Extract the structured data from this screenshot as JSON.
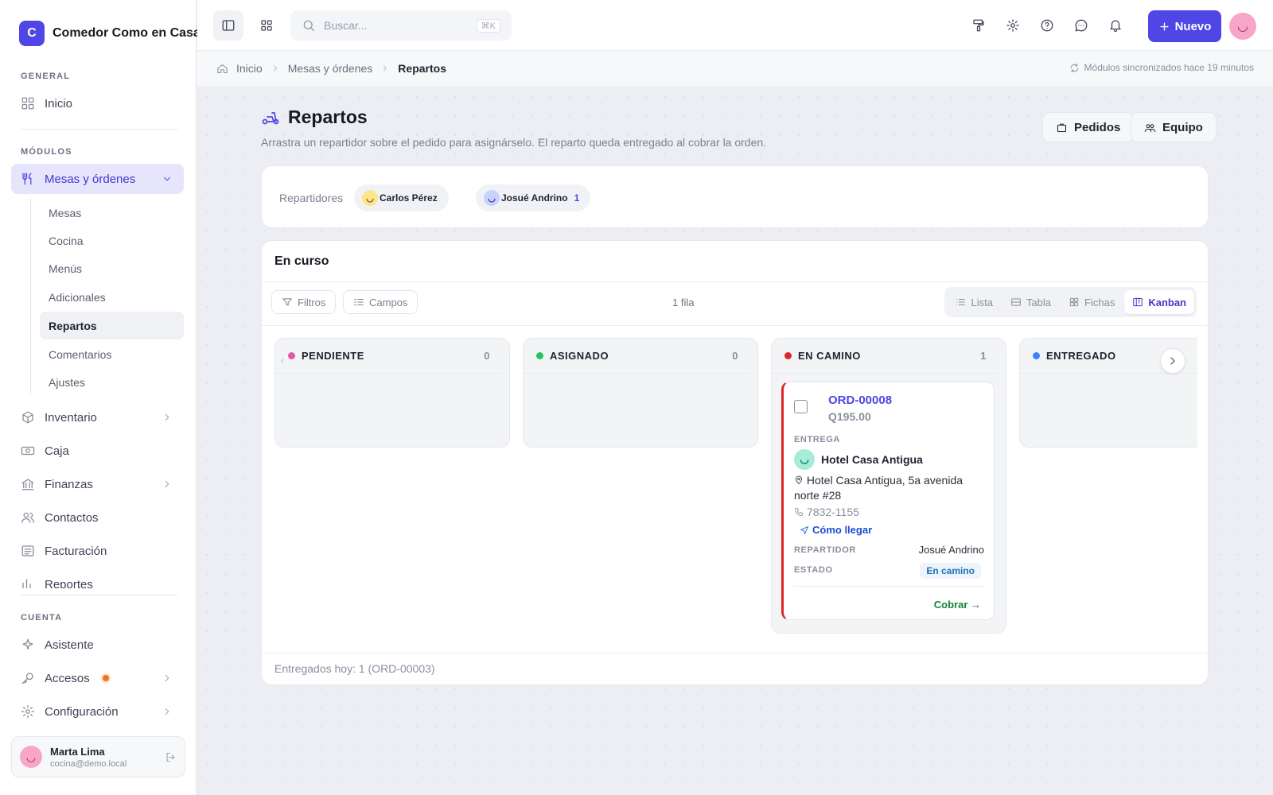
{
  "brand": {
    "initial": "C",
    "name": "Comedor Como en Casa"
  },
  "sidebar": {
    "general_label": "GENERAL",
    "home": "Inicio",
    "modules_label": "MÓDULOS",
    "mesas": "Mesas y órdenes",
    "subitems": [
      "Mesas",
      "Cocina",
      "Menús",
      "Adicionales",
      "Repartos",
      "Comentarios",
      "Ajustes"
    ],
    "inventario": "Inventario",
    "caja": "Caja",
    "finanzas": "Finanzas",
    "contactos": "Contactos",
    "facturacion": "Facturación",
    "reportes": "Reportes",
    "account_label": "CUENTA",
    "asistente": "Asistente",
    "accesos": "Accesos",
    "configuracion": "Configuración"
  },
  "user": {
    "name": "Marta Lima",
    "email": "cocina@demo.local"
  },
  "topbar": {
    "search_placeholder": "Buscar...",
    "shortcut": "⌘K",
    "new_label": "Nuevo"
  },
  "breadcrumb": {
    "home": "Inicio",
    "section": "Mesas y órdenes",
    "current": "Repartos",
    "sync": "Módulos sincronizados hace 19 minutos"
  },
  "page": {
    "title": "Repartos",
    "subtitle": "Arrastra un repartidor sobre el pedido para asignárselo. El reparto queda entregado al cobrar la orden.",
    "btn_orders": "Pedidos",
    "btn_team": "Equipo"
  },
  "repartidores": {
    "label": "Repartidores",
    "items": [
      {
        "name": "Carlos Pérez",
        "count": ""
      },
      {
        "name": "Josué Andrino",
        "count": "1"
      }
    ]
  },
  "board": {
    "title": "En curso",
    "filters": "Filtros",
    "fields": "Campos",
    "rows": "1 fila",
    "views": [
      "Lista",
      "Tabla",
      "Fichas",
      "Kanban"
    ],
    "active_view": "Kanban",
    "columns": [
      {
        "name": "PENDIENTE",
        "count": "0",
        "color": "#e05aa8"
      },
      {
        "name": "ASIGNADO",
        "count": "0",
        "color": "#22c55e"
      },
      {
        "name": "EN CAMINO",
        "count": "1",
        "color": "#dc2626"
      },
      {
        "name": "ENTREGADO",
        "count": "",
        "color": "#3b82f6"
      }
    ],
    "footer": "Entregados hoy: 1 (ORD-00003)"
  },
  "order": {
    "id": "ORD-00008",
    "amount": "Q195.00",
    "delivery_label": "ENTREGA",
    "place": "Hotel Casa Antigua",
    "address": "Hotel Casa Antigua, 5a avenida norte #28",
    "phone": "7832-1155",
    "route": "Cómo llegar",
    "rep_label": "REPARTIDOR",
    "rep_value": "Josué Andrino",
    "status_label": "ESTADO",
    "status_value": "En camino",
    "action": "Cobrar →"
  }
}
